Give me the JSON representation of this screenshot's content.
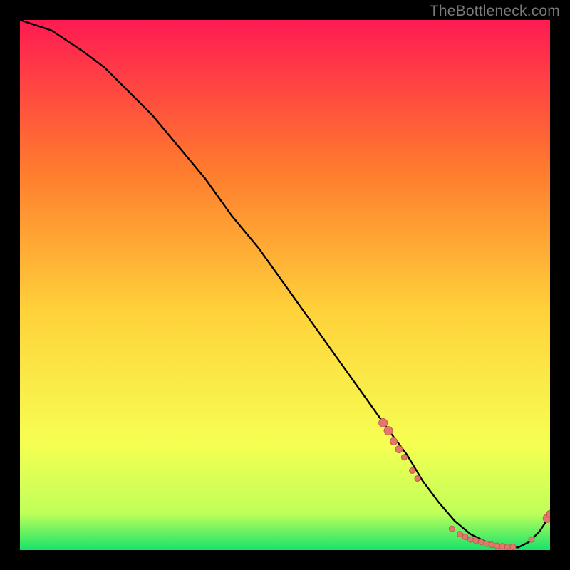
{
  "watermark": "TheBottleneck.com",
  "colors": {
    "background": "#000000",
    "gradient_top": "#ff1a52",
    "gradient_upper_mid": "#ff7a2e",
    "gradient_mid": "#ffd23a",
    "gradient_lower_mid": "#f6ff52",
    "gradient_bottom_band": "#bfff59",
    "gradient_bottom": "#17e36a",
    "curve": "#000000",
    "marker_fill": "#e2786b",
    "marker_stroke": "#c25a4e"
  },
  "chart_data": {
    "type": "line",
    "title": "",
    "xlabel": "",
    "ylabel": "",
    "xlim": [
      0,
      100
    ],
    "ylim": [
      0,
      100
    ],
    "series": [
      {
        "name": "curve",
        "x": [
          0,
          3,
          6,
          9,
          12,
          16,
          20,
          25,
          30,
          35,
          40,
          45,
          50,
          55,
          60,
          65,
          70,
          73,
          76,
          79,
          82,
          85,
          88,
          91,
          94,
          96,
          98,
          100
        ],
        "y": [
          100,
          99,
          98,
          96,
          94,
          91,
          87,
          82,
          76,
          70,
          63,
          57,
          50,
          43,
          36,
          29,
          22,
          18,
          13,
          9,
          5.5,
          3,
          1.5,
          0.7,
          0.5,
          1.5,
          3.5,
          6.5
        ]
      }
    ],
    "markers": [
      {
        "x": 68.5,
        "y": 24.0,
        "r": 6
      },
      {
        "x": 69.5,
        "y": 22.5,
        "r": 6
      },
      {
        "x": 70.5,
        "y": 20.5,
        "r": 5
      },
      {
        "x": 71.5,
        "y": 19.0,
        "r": 5
      },
      {
        "x": 72.5,
        "y": 17.5,
        "r": 4
      },
      {
        "x": 74.0,
        "y": 15.0,
        "r": 4
      },
      {
        "x": 75.0,
        "y": 13.5,
        "r": 4
      },
      {
        "x": 81.5,
        "y": 4.0,
        "r": 4
      },
      {
        "x": 83.0,
        "y": 3.0,
        "r": 4
      },
      {
        "x": 84.0,
        "y": 2.5,
        "r": 4
      },
      {
        "x": 85.0,
        "y": 2.0,
        "r": 4
      },
      {
        "x": 86.0,
        "y": 1.8,
        "r": 4
      },
      {
        "x": 87.0,
        "y": 1.5,
        "r": 4
      },
      {
        "x": 88.0,
        "y": 1.2,
        "r": 4
      },
      {
        "x": 89.0,
        "y": 1.0,
        "r": 4
      },
      {
        "x": 90.0,
        "y": 0.8,
        "r": 4
      },
      {
        "x": 91.0,
        "y": 0.7,
        "r": 4
      },
      {
        "x": 92.0,
        "y": 0.6,
        "r": 4
      },
      {
        "x": 93.0,
        "y": 0.6,
        "r": 4
      },
      {
        "x": 96.5,
        "y": 2.0,
        "r": 4
      },
      {
        "x": 99.5,
        "y": 6.0,
        "r": 6
      },
      {
        "x": 100.0,
        "y": 6.8,
        "r": 5
      }
    ]
  }
}
